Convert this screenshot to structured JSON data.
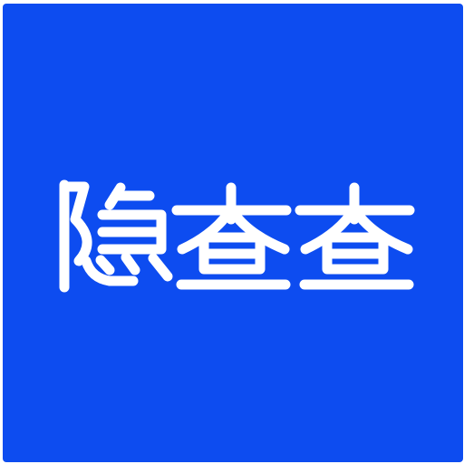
{
  "logo": {
    "wordmark": "隐查查",
    "background_color": "#0d4cf0",
    "text_color": "#ffffff"
  }
}
